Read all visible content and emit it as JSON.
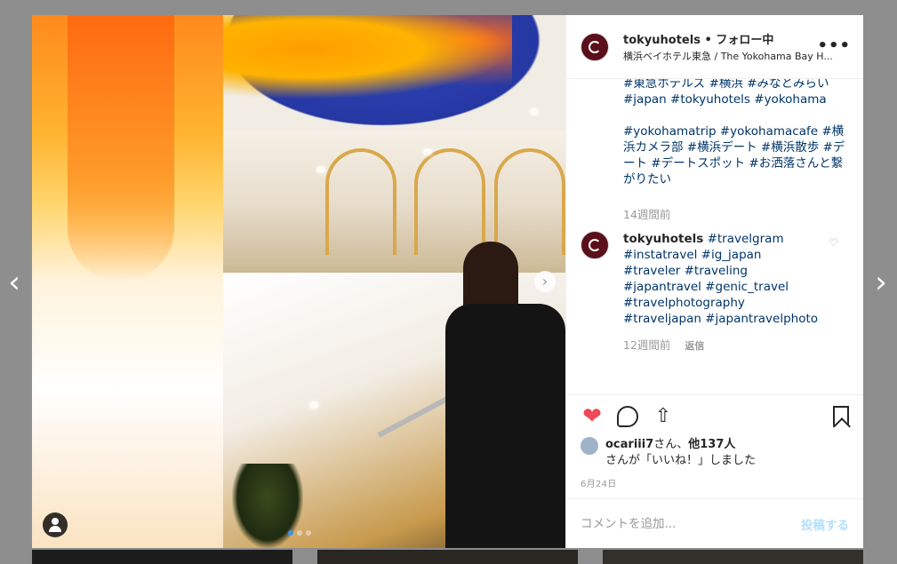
{
  "nav": {
    "prev_arrow": "‹",
    "next_arrow": "›"
  },
  "post": {
    "username": "tokyuhotels",
    "separator": "•",
    "follow_status": "フォロー中",
    "location": "横浜ベイホテル東急 / The Yokohama Bay H...",
    "more": "•••",
    "photo_next": "›",
    "caption_lines": [
      "#東急ホテルズ #横浜 #みなとみらい #japan #tokyuhotels #yokohama",
      "#yokohamatrip #yokohamacafe #横浜カメラ部 #横浜デート #横浜散歩 #デート #デートスポット #お洒落さんと繋がりたい"
    ],
    "caption_time": "14週間前",
    "comment": {
      "username": "tokyuhotels",
      "text": "#travelgram #instatravel #ig_japan #traveler #traveling #japantravel #genic_travel #travelphotography #traveljapan #japantravelphoto",
      "time": "12週間前",
      "reply": "返信",
      "like_icon": "♡"
    },
    "likes": {
      "user": "ocariii7",
      "suffix": "さん、",
      "others": "他137人",
      "line2": "さんが「いいね！」しました"
    },
    "date": "6月24日",
    "comment_placeholder": "コメントを追加...",
    "post_button": "投稿する"
  },
  "icons": {
    "heart": "heart-icon",
    "comment": "comment-icon",
    "share": "share-icon",
    "bookmark": "bookmark-icon",
    "user_tag": "user-tag-icon"
  },
  "colors": {
    "heart": "#ed4956",
    "hashtag": "#003569",
    "muted": "#999999",
    "post_button": "#b2dffc",
    "dot_active": "#3897f0"
  }
}
